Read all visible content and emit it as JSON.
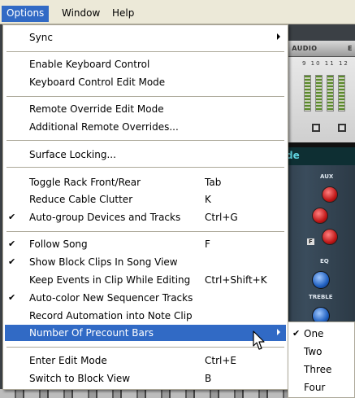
{
  "menubar": {
    "items": [
      {
        "label": "Options"
      },
      {
        "label": "Window"
      },
      {
        "label": "Help"
      }
    ]
  },
  "background": {
    "rack_tabs": [
      "E AUDIO",
      "E"
    ],
    "meter_numbers": "9 10 11 12",
    "rack_name": "de",
    "mixer_labels": [
      "AUX",
      "EQ",
      "TREBLE",
      "F"
    ]
  },
  "options_menu": {
    "items": [
      {
        "label": "Sync",
        "shortcut": "",
        "checked": false,
        "submenu": true
      },
      {
        "label": "Enable Keyboard Control",
        "shortcut": "",
        "checked": false
      },
      {
        "label": "Keyboard Control Edit Mode",
        "shortcut": "",
        "checked": false
      },
      {
        "label": "Remote Override Edit Mode",
        "shortcut": "",
        "checked": false
      },
      {
        "label": "Additional Remote Overrides...",
        "shortcut": "",
        "checked": false
      },
      {
        "label": "Surface Locking...",
        "shortcut": "",
        "checked": false
      },
      {
        "label": "Toggle Rack Front/Rear",
        "shortcut": "Tab",
        "checked": false
      },
      {
        "label": "Reduce Cable Clutter",
        "shortcut": "K",
        "checked": false
      },
      {
        "label": "Auto-group Devices and Tracks",
        "shortcut": "Ctrl+G",
        "checked": true
      },
      {
        "label": "Follow Song",
        "shortcut": "F",
        "checked": true
      },
      {
        "label": "Show Block Clips In Song View",
        "shortcut": "",
        "checked": true
      },
      {
        "label": "Keep Events in Clip While Editing",
        "shortcut": "Ctrl+Shift+K",
        "checked": false
      },
      {
        "label": "Auto-color New Sequencer Tracks",
        "shortcut": "",
        "checked": true
      },
      {
        "label": "Record Automation into Note Clip",
        "shortcut": "",
        "checked": false
      },
      {
        "label": "Number Of Precount Bars",
        "shortcut": "",
        "checked": false,
        "submenu": true,
        "highlighted": true
      },
      {
        "label": "Enter Edit Mode",
        "shortcut": "Ctrl+E",
        "checked": false
      },
      {
        "label": "Switch to Block View",
        "shortcut": "B",
        "checked": false
      }
    ]
  },
  "precount_submenu": {
    "items": [
      {
        "label": "One",
        "checked": true
      },
      {
        "label": "Two",
        "checked": false
      },
      {
        "label": "Three",
        "checked": false
      },
      {
        "label": "Four",
        "checked": false
      }
    ]
  },
  "glyphs": {
    "check": "✔"
  },
  "colors": {
    "highlight": "#316ac5",
    "menubar": "#ece9d8",
    "menu_bg": "#ffffff"
  }
}
